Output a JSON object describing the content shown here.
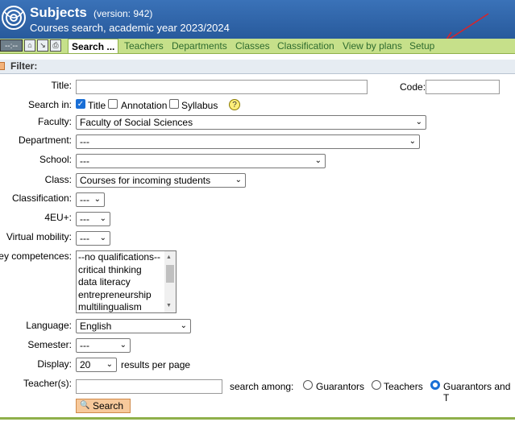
{
  "header": {
    "title": "Subjects",
    "version": "(version: 942)",
    "subtitle": "Courses search, academic year 2023/2024"
  },
  "toolbar": {
    "user_placeholder": "--:--",
    "icons": [
      "home-icon",
      "login-icon",
      "print-icon"
    ]
  },
  "tabs": [
    {
      "label": "Search ...",
      "active": true
    },
    {
      "label": "Teachers"
    },
    {
      "label": "Departments"
    },
    {
      "label": "Classes"
    },
    {
      "label": "Classification"
    },
    {
      "label": "View by plans"
    },
    {
      "label": "Setup"
    }
  ],
  "filter": {
    "label": "Filter:",
    "title_label": "Title:",
    "title_value": "",
    "code_label": "Code:",
    "code_value": "",
    "search_in_label": "Search in:",
    "search_in": [
      {
        "label": "Title",
        "checked": true
      },
      {
        "label": "Annotation",
        "checked": false
      },
      {
        "label": "Syllabus",
        "checked": false
      }
    ],
    "faculty_label": "Faculty:",
    "faculty_value": "Faculty of Social Sciences",
    "department_label": "Department:",
    "department_value": "---",
    "school_label": "School:",
    "school_value": "---",
    "class_label": "Class:",
    "class_value": "Courses for incoming students",
    "classification_label": "Classification:",
    "classification_value": "---",
    "eu_label": "4EU+:",
    "eu_value": "---",
    "virtual_label": "Virtual mobility:",
    "virtual_value": "---",
    "competences_label": "Key competences:",
    "competences_options": [
      "--no qualifications--",
      "critical thinking",
      "data literacy",
      "entrepreneurship",
      "multilingualism"
    ],
    "language_label": "Language:",
    "language_value": "English",
    "semester_label": "Semester:",
    "semester_value": "---",
    "display_label": "Display:",
    "display_value": "20",
    "display_suffix": "results per page",
    "teachers_label": "Teacher(s):",
    "teachers_value": "",
    "search_among_label": "search among:",
    "search_among": [
      {
        "label": "Guarantors",
        "selected": false
      },
      {
        "label": "Teachers",
        "selected": false
      },
      {
        "label": "Guarantors and T",
        "selected": true
      }
    ],
    "search_button": "Search"
  }
}
